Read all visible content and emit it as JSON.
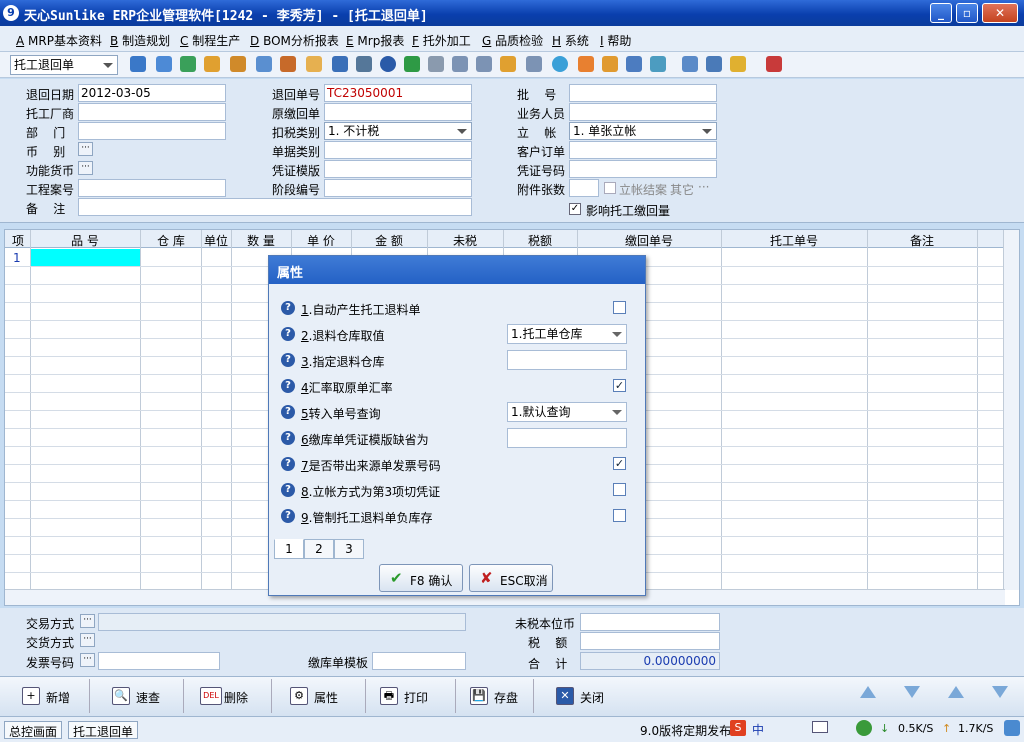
{
  "window": {
    "title": "天心Sunlike ERP企业管理软件[1242 - 李秀芳] - [托工退回单]",
    "minimize": "_",
    "restore": "▫",
    "close": "✕"
  },
  "menu": [
    {
      "key": "A",
      "label": "MRP基本资料"
    },
    {
      "key": "B",
      "label": "制造规划"
    },
    {
      "key": "C",
      "label": "制程生产"
    },
    {
      "key": "D",
      "label": "BOM分析报表"
    },
    {
      "key": "E",
      "label": "Mrp报表"
    },
    {
      "key": "F",
      "label": "托外加工"
    },
    {
      "key": "G",
      "label": "品质检验"
    },
    {
      "key": "H",
      "label": "系统"
    },
    {
      "key": "I",
      "label": "帮助"
    }
  ],
  "toolbar": {
    "doc_type": "托工退回单"
  },
  "form": {
    "return_date_label": "退回日期",
    "return_date": "2012-03-05",
    "vendor_label": "托工厂商",
    "vendor": "",
    "dept_label": "部    门",
    "dept": "",
    "currency_label": "币    别",
    "func_currency_label": "功能货币",
    "project_label": "工程案号",
    "project": "",
    "remark_label": "备    注",
    "remark": "",
    "return_no_label": "退回单号",
    "return_no": "TC23050001",
    "orig_label": "原缴回单",
    "orig": "",
    "tax_label": "扣税类别",
    "tax_value": "1. 不计税",
    "doc_cat_label": "单据类别",
    "voucher_tpl_label": "凭证模版",
    "stage_label": "阶段编号",
    "stage": "",
    "batch_label": "批    号",
    "batch": "",
    "sales_label": "业务人员",
    "sales": "",
    "account_label": "立    帐",
    "account_value": "1. 单张立帐",
    "cust_order_label": "客户订单",
    "voucher_no_label": "凭证号码",
    "attach_label": "附件张数",
    "attach_chk_label": "立帐结案",
    "other_label": "其它",
    "impact_label": "影响托工缴回量"
  },
  "grid": {
    "headers": [
      "项",
      "品    号",
      "仓  库",
      "单位",
      "数  量",
      "单  价",
      "金  额",
      "未税",
      "税额",
      "缴回单号",
      "托工单号",
      "备注"
    ],
    "row_no": "1"
  },
  "footer": {
    "trade_label": "交易方式",
    "delivery_label": "交货方式",
    "invoice_label": "发票号码",
    "tpl_label": "缴库单模板",
    "untaxed_label": "未税本位币",
    "tax_label": "税    额",
    "total_label": "合    计",
    "total_value": "0.00000000"
  },
  "bottom_buttons": [
    "新增",
    "速查",
    "删除",
    "属性",
    "打印",
    "存盘",
    "关闭"
  ],
  "bottom_icons": [
    "+",
    "🔍",
    "DEL",
    "⚙",
    "🖶",
    "💾",
    "✕"
  ],
  "status": {
    "tab1": "总控画面",
    "tab2": "托工退回单",
    "notice": "9.0版将定期发布",
    "down": "0.5K/S",
    "up": "1.7K/S"
  },
  "dialog": {
    "title": "属性",
    "items": [
      {
        "num": "1",
        "text": ".自动产生托工退料单",
        "control": "checkbox",
        "checked": false
      },
      {
        "num": "2",
        "text": ".退料仓库取值",
        "control": "select",
        "value": "1.托工单仓库"
      },
      {
        "num": "3",
        "text": ".指定退料仓库",
        "control": "input",
        "value": ""
      },
      {
        "num": "4",
        "text": "汇率取原单汇率",
        "control": "checkbox",
        "checked": true
      },
      {
        "num": "5",
        "text": "转入单号查询",
        "control": "select",
        "value": "1.默认查询"
      },
      {
        "num": "6",
        "text": "缴库单凭证模版缺省为",
        "control": "input",
        "value": ""
      },
      {
        "num": "7",
        "text": "是否带出来源单发票号码",
        "control": "checkbox",
        "checked": true
      },
      {
        "num": "8",
        "text": ".立帐方式为第3项切凭证",
        "control": "checkbox",
        "checked": false
      },
      {
        "num": "9",
        "text": ".管制托工退料单负库存",
        "control": "checkbox",
        "checked": false
      }
    ],
    "tabs": [
      "1",
      "2",
      "3"
    ],
    "ok_label": "F8 确认",
    "cancel_label": "ESC取消"
  },
  "colors": {
    "title_bar": "#0a3fae",
    "accent_cyan": "#00ffff",
    "doc_no_red": "#c00000",
    "total_blue": "#1a3cb0"
  }
}
